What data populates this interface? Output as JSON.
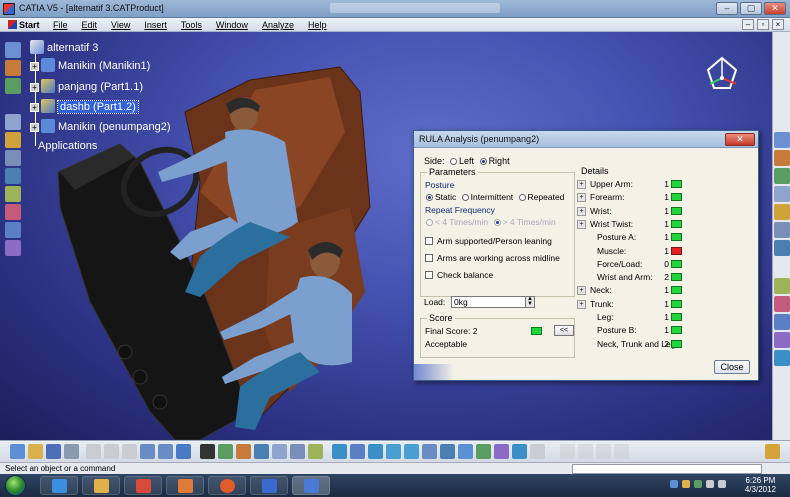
{
  "window": {
    "title": "CATIA V5 - [alternatif 3.CATProduct]",
    "min": "–",
    "max": "▢",
    "close": "✕"
  },
  "menu": {
    "start": "Start",
    "items": [
      "File",
      "Edit",
      "View",
      "Insert",
      "Tools",
      "Window",
      "Analyze",
      "Help"
    ],
    "right_buttons": [
      "–",
      "▫",
      "×"
    ]
  },
  "tree": {
    "root": "alternatif 3",
    "nodes": [
      "Manikin (Manikin1)",
      "panjang (Part1.1)",
      "dashb (Part1.2)",
      "Manikin (penumpang2)"
    ],
    "applications": "Applications",
    "selected_index": 2
  },
  "dialog": {
    "title": "RULA Analysis (penumpang2)",
    "close_x": "✕",
    "side_label": "Side:",
    "side_left": "Left",
    "side_right": "Right",
    "side_selected": "Right",
    "parameters_label": "Parameters",
    "posture_label": "Posture",
    "posture_static": "Static",
    "posture_intermittent": "Intermittent",
    "posture_repeated": "Repeated",
    "posture_selected": "Static",
    "repeat_freq_label": "Repeat Frequency",
    "freq_less": "< 4 Times/min",
    "freq_more": "> 4 Times/min",
    "check_arm": "Arm supported/Person leaning",
    "check_midline": "Arms are working across midline",
    "check_balance": "Check balance",
    "load_label": "Load:",
    "load_value": "0kg",
    "score_label": "Score",
    "final_score": "Final Score: 2",
    "acceptable": "Acceptable",
    "collapse_btn": "<<",
    "details_label": "Details",
    "details": [
      {
        "label": "Upper Arm:",
        "value": "1",
        "color": "#20d63a",
        "expand": true
      },
      {
        "label": "Forearm:",
        "value": "1",
        "color": "#20d63a",
        "expand": true
      },
      {
        "label": "Wrist:",
        "value": "1",
        "color": "#20d63a",
        "expand": true
      },
      {
        "label": "Wrist Twist:",
        "value": "1",
        "color": "#20d63a",
        "expand": true
      },
      {
        "label": "Posture A:",
        "value": "1",
        "color": "#20d63a",
        "expand": false
      },
      {
        "label": "Muscle:",
        "value": "1",
        "color": "#e52222",
        "expand": false
      },
      {
        "label": "Force/Load:",
        "value": "0",
        "color": "#20d63a",
        "expand": false
      },
      {
        "label": "Wrist and Arm:",
        "value": "2",
        "color": "#20d63a",
        "expand": false
      },
      {
        "label": "Neck:",
        "value": "1",
        "color": "#20d63a",
        "expand": true
      },
      {
        "label": "Trunk:",
        "value": "1",
        "color": "#20d63a",
        "expand": true
      },
      {
        "label": "Leg:",
        "value": "1",
        "color": "#20d63a",
        "expand": false
      },
      {
        "label": "Posture B:",
        "value": "1",
        "color": "#20d63a",
        "expand": false
      },
      {
        "label": "Neck, Trunk and Leg:",
        "value": "2",
        "color": "#20d63a",
        "expand": false
      }
    ],
    "close_button": "Close"
  },
  "status": {
    "message": "Select an object or a command"
  },
  "taskbar": {
    "time": "6:26 PM",
    "date": "4/3/2012"
  },
  "colors": {
    "viewport_bg": "#4552b1",
    "green_ok": "#20d63a",
    "red_alert": "#e52222",
    "selection": "#3361d8"
  }
}
